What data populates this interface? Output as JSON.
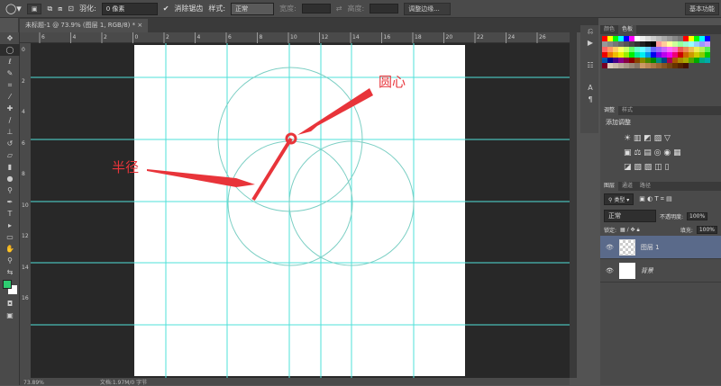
{
  "options_bar": {
    "feather_label": "羽化:",
    "feather_value": "0 像素",
    "antialias_label": "消除锯齿",
    "style_label": "样式:",
    "style_value": "正常",
    "width_label": "宽度:",
    "height_label": "高度:",
    "refine_edge": "调整边缘...",
    "workspace": "基本功能"
  },
  "document": {
    "tab_title": "未标题-1 @ 73.9% (图层 1, RGB/8) *",
    "zoom": "73.89%",
    "doc_info": "文档:1.97M/0 字节"
  },
  "ruler_top": [
    "6",
    "4",
    "2",
    "0",
    "2",
    "4",
    "6",
    "8",
    "10",
    "12",
    "14",
    "16",
    "18",
    "20",
    "22",
    "24",
    "26"
  ],
  "ruler_left": [
    "0",
    "2",
    "4",
    "6",
    "8",
    "10",
    "12",
    "14",
    "16"
  ],
  "annotations": {
    "center_label": "圆心",
    "radius_label": "半径",
    "annotation_color": "#e8343a",
    "guide_color": "#4fe0d8"
  },
  "swatches_panel": {
    "tabs": [
      "颜色",
      "色板"
    ]
  },
  "adjust_panel": {
    "tabs": [
      "调整",
      "样式"
    ],
    "title": "添加调整"
  },
  "layers_panel": {
    "tabs": [
      "图层",
      "通道",
      "路径"
    ],
    "filter": "类型",
    "blend_mode": "正常",
    "opacity_label": "不透明度:",
    "opacity": "100%",
    "lock_label": "锁定:",
    "fill_label": "填充:",
    "fill": "100%",
    "layers": [
      {
        "name": "图层 1",
        "selected": true
      },
      {
        "name": "背景",
        "selected": false
      }
    ]
  },
  "colors": {
    "foreground": "#2ecc71",
    "background": "#ffffff",
    "selected_layer": "#5a6a8a"
  }
}
